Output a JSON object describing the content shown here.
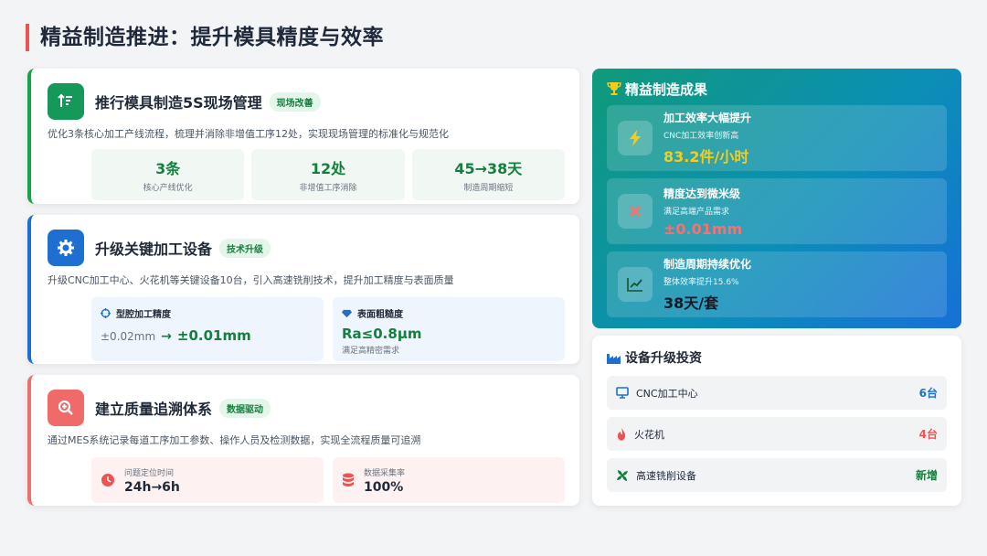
{
  "page": {
    "title": "精益制造推进：提升模具精度与效率"
  },
  "card1": {
    "title": "推行模具制造5S现场管理",
    "badge": "现场改善",
    "desc": "优化3条核心加工产线流程，梳理并消除非增值工序12处，实现现场管理的标准化与规范化",
    "stats": [
      {
        "value": "3条",
        "label": "核心产线优化"
      },
      {
        "value": "12处",
        "label": "非增值工序消除"
      },
      {
        "value": "45→38天",
        "label": "制造周期缩短"
      }
    ],
    "icon": "sort-icon"
  },
  "card2": {
    "title": "升级关键加工设备",
    "badge": "技术升级",
    "desc": "升级CNC加工中心、火花机等关键设备10台，引入高速铣削技术，提升加工精度与表面质量",
    "icon": "gear-icon",
    "spec1": {
      "label": "型腔加工精度",
      "old": "±0.02mm",
      "arrow": "→",
      "new": "±0.01mm"
    },
    "spec2": {
      "label": "表面粗糙度",
      "value": "Ra≤0.8μm",
      "note": "满足高精密需求"
    }
  },
  "card3": {
    "title": "建立质量追溯体系",
    "badge": "数据驱动",
    "desc": "通过MES系统记录每道工序加工参数、操作人员及检测数据，实现全流程质量可追溯",
    "icon": "search-plus-icon",
    "metrics": [
      {
        "label": "问题定位时间",
        "value": "24h→6h"
      },
      {
        "label": "数据采集率",
        "value": "100%"
      }
    ]
  },
  "results": {
    "title": "精益制造成果",
    "items": [
      {
        "name": "加工效率大幅提升",
        "sub": "CNC加工效率创新高",
        "value": "83.2件/小时",
        "color": "#facc15",
        "icon": "bolt-icon"
      },
      {
        "name": "精度达到微米级",
        "sub": "满足高端产品需求",
        "value": "±0.01mm",
        "color": "#f87171",
        "icon": "crosshair-icon"
      },
      {
        "name": "制造周期持续优化",
        "sub": "整体效率提升15.6%",
        "value": "38天/套",
        "color": "#111827",
        "icon": "chart-line-icon"
      }
    ]
  },
  "invest": {
    "title": "设备升级投资",
    "rows": [
      {
        "name": "CNC加工中心",
        "value": "6台",
        "color": "#1e6fd0",
        "icon": "monitor-icon"
      },
      {
        "name": "火花机",
        "value": "4台",
        "color": "#ef5350",
        "icon": "fire-icon"
      },
      {
        "name": "高速铣削设备",
        "value": "新增",
        "color": "#15803d",
        "icon": "fan-icon"
      }
    ]
  },
  "colors": {
    "green": "#15803d",
    "blue": "#1e6fd0",
    "red": "#ef5350",
    "gradient_start": "#0f9a7a",
    "gradient_end": "#1670d8"
  }
}
